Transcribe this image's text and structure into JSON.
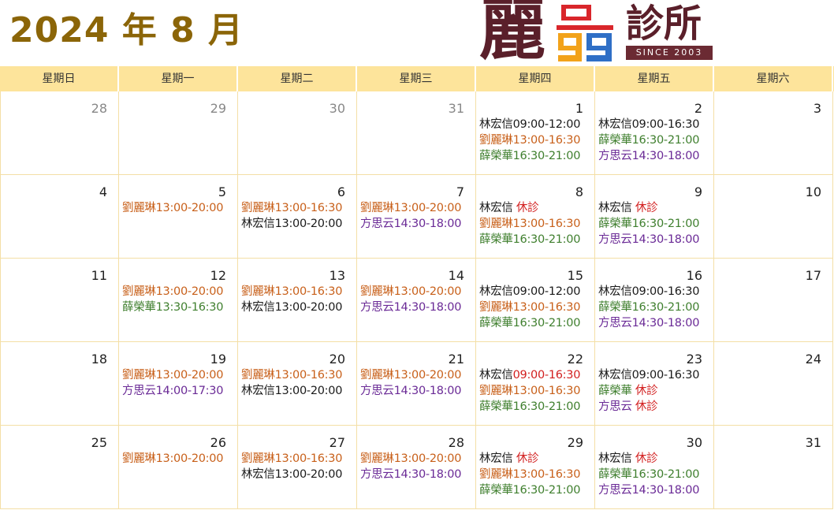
{
  "title": "2024 年 8 月",
  "logo": {
    "main": "麗",
    "badge": "99",
    "clinic": "診所",
    "since": "SINCE 2003"
  },
  "colors": {
    "lin": "#1a1a1a",
    "liu": "#c8601a",
    "xue": "#3f7f2e",
    "fang": "#6a2a96",
    "off": "#d21f1f",
    "header_bg": "#fde49b",
    "title": "#8b6508"
  },
  "weekdays": [
    "星期日",
    "星期一",
    "星期二",
    "星期三",
    "星期四",
    "星期五",
    "星期六"
  ],
  "weeks": [
    [
      {
        "day": "28",
        "other": true,
        "events": []
      },
      {
        "day": "29",
        "other": true,
        "events": []
      },
      {
        "day": "30",
        "other": true,
        "events": []
      },
      {
        "day": "31",
        "other": true,
        "events": []
      },
      {
        "day": "1",
        "events": [
          {
            "who": "lin",
            "name": "林宏信",
            "time": "09:00-12:00"
          },
          {
            "who": "liu",
            "name": "劉麗琳",
            "time": "13:00-16:30"
          },
          {
            "who": "xue",
            "name": "薛榮華",
            "time": "16:30-21:00"
          }
        ]
      },
      {
        "day": "2",
        "events": [
          {
            "who": "lin",
            "name": "林宏信",
            "time": "09:00-16:30"
          },
          {
            "who": "xue",
            "name": "薛榮華",
            "time": "16:30-21:00"
          },
          {
            "who": "fang",
            "name": "方思云",
            "time": "14:30-18:00"
          }
        ]
      },
      {
        "day": "3",
        "events": []
      }
    ],
    [
      {
        "day": "4",
        "events": []
      },
      {
        "day": "5",
        "events": [
          {
            "who": "liu",
            "name": "劉麗琳",
            "time": "13:00-20:00"
          }
        ]
      },
      {
        "day": "6",
        "events": [
          {
            "who": "liu",
            "name": "劉麗琳",
            "time": "13:00-16:30"
          },
          {
            "who": "lin",
            "name": "林宏信",
            "time": "13:00-20:00"
          }
        ]
      },
      {
        "day": "7",
        "events": [
          {
            "who": "liu",
            "name": "劉麗琳",
            "time": "13:00-20:00"
          },
          {
            "who": "fang",
            "name": "方思云",
            "time": "14:30-18:00"
          }
        ]
      },
      {
        "day": "8",
        "events": [
          {
            "who": "lin",
            "name": "林宏信",
            "off": "休診"
          },
          {
            "who": "liu",
            "name": "劉麗琳",
            "time": "13:00-16:30"
          },
          {
            "who": "xue",
            "name": "薛榮華",
            "time": "16:30-21:00"
          }
        ]
      },
      {
        "day": "9",
        "events": [
          {
            "who": "lin",
            "name": "林宏信",
            "off": "休診"
          },
          {
            "who": "xue",
            "name": "薛榮華",
            "time": "16:30-21:00"
          },
          {
            "who": "fang",
            "name": "方思云",
            "time": "14:30-18:00"
          }
        ]
      },
      {
        "day": "10",
        "events": []
      }
    ],
    [
      {
        "day": "11",
        "events": []
      },
      {
        "day": "12",
        "events": [
          {
            "who": "liu",
            "name": "劉麗琳",
            "time": "13:00-20:00"
          },
          {
            "who": "xue",
            "name": "薛榮華",
            "time": "13:30-16:30"
          }
        ]
      },
      {
        "day": "13",
        "events": [
          {
            "who": "liu",
            "name": "劉麗琳",
            "time": "13:00-16:30"
          },
          {
            "who": "lin",
            "name": "林宏信",
            "time": "13:00-20:00"
          }
        ]
      },
      {
        "day": "14",
        "events": [
          {
            "who": "liu",
            "name": "劉麗琳",
            "time": "13:00-20:00"
          },
          {
            "who": "fang",
            "name": "方思云",
            "time": "14:30-18:00"
          }
        ]
      },
      {
        "day": "15",
        "events": [
          {
            "who": "lin",
            "name": "林宏信",
            "time": "09:00-12:00"
          },
          {
            "who": "liu",
            "name": "劉麗琳",
            "time": "13:00-16:30"
          },
          {
            "who": "xue",
            "name": "薛榮華",
            "time": "16:30-21:00"
          }
        ]
      },
      {
        "day": "16",
        "events": [
          {
            "who": "lin",
            "name": "林宏信",
            "time": "09:00-16:30"
          },
          {
            "who": "xue",
            "name": "薛榮華",
            "time": "16:30-21:00"
          },
          {
            "who": "fang",
            "name": "方思云",
            "time": "14:30-18:00"
          }
        ]
      },
      {
        "day": "17",
        "events": []
      }
    ],
    [
      {
        "day": "18",
        "events": []
      },
      {
        "day": "19",
        "events": [
          {
            "who": "liu",
            "name": "劉麗琳",
            "time": "13:00-20:00"
          },
          {
            "who": "fang",
            "name": "方思云",
            "time": "14:00-17:30"
          }
        ]
      },
      {
        "day": "20",
        "events": [
          {
            "who": "liu",
            "name": "劉麗琳",
            "time": "13:00-16:30"
          },
          {
            "who": "lin",
            "name": "林宏信",
            "time": "13:00-20:00"
          }
        ]
      },
      {
        "day": "21",
        "events": [
          {
            "who": "liu",
            "name": "劉麗琳",
            "time": "13:00-20:00"
          },
          {
            "who": "fang",
            "name": "方思云",
            "time": "14:30-18:00"
          }
        ]
      },
      {
        "day": "22",
        "events": [
          {
            "who": "lin",
            "name": "林宏信",
            "time": "09:00-16:30",
            "time_red": true
          },
          {
            "who": "liu",
            "name": "劉麗琳",
            "time": "13:00-16:30"
          },
          {
            "who": "xue",
            "name": "薛榮華",
            "time": "16:30-21:00"
          }
        ]
      },
      {
        "day": "23",
        "events": [
          {
            "who": "lin",
            "name": "林宏信",
            "time": "09:00-16:30"
          },
          {
            "who": "xue",
            "name": "薛榮華",
            "off": "休診"
          },
          {
            "who": "fang",
            "name": "方思云",
            "off": "休診"
          }
        ]
      },
      {
        "day": "24",
        "events": []
      }
    ],
    [
      {
        "day": "25",
        "events": []
      },
      {
        "day": "26",
        "events": [
          {
            "who": "liu",
            "name": "劉麗琳",
            "time": "13:00-20:00"
          }
        ]
      },
      {
        "day": "27",
        "events": [
          {
            "who": "liu",
            "name": "劉麗琳",
            "time": "13:00-16:30"
          },
          {
            "who": "lin",
            "name": "林宏信",
            "time": "13:00-20:00"
          }
        ]
      },
      {
        "day": "28",
        "events": [
          {
            "who": "liu",
            "name": "劉麗琳",
            "time": "13:00-20:00"
          },
          {
            "who": "fang",
            "name": "方思云",
            "time": "14:30-18:00"
          }
        ]
      },
      {
        "day": "29",
        "events": [
          {
            "who": "lin",
            "name": "林宏信",
            "off": "休診"
          },
          {
            "who": "liu",
            "name": "劉麗琳",
            "time": "13:00-16:30"
          },
          {
            "who": "xue",
            "name": "薛榮華",
            "time": "16:30-21:00"
          }
        ]
      },
      {
        "day": "30",
        "events": [
          {
            "who": "lin",
            "name": "林宏信",
            "off": "休診"
          },
          {
            "who": "xue",
            "name": "薛榮華",
            "time": "16:30-21:00"
          },
          {
            "who": "fang",
            "name": "方思云",
            "time": "14:30-18:00"
          }
        ]
      },
      {
        "day": "31",
        "events": []
      }
    ]
  ]
}
